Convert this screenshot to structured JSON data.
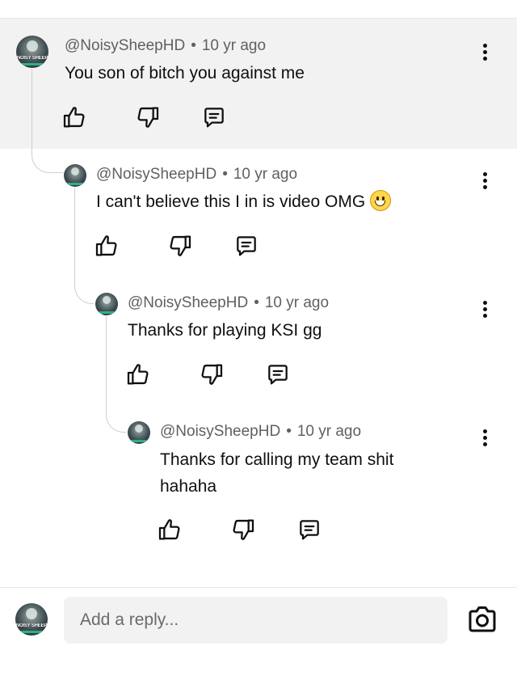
{
  "comments": [
    {
      "author": "@NoisySheepHD",
      "separator": "•",
      "time": "10 yr ago",
      "text": "You son of bitch you against me",
      "avatar_text": "NOISY SHEEP",
      "avatar_icon": "avatar-image",
      "highlighted": true
    },
    {
      "author": "@NoisySheepHD",
      "separator": "•",
      "time": "10 yr ago",
      "text": "I can't believe this I in is video OMG",
      "emoji": "grinning-face-emoji",
      "avatar_icon": "avatar-image"
    },
    {
      "author": "@NoisySheepHD",
      "separator": "•",
      "time": "10 yr ago",
      "text": "Thanks for playing KSI gg",
      "avatar_icon": "avatar-image"
    },
    {
      "author": "@NoisySheepHD",
      "separator": "•",
      "time": "10 yr ago",
      "text": "Thanks for calling my team shit hahaha",
      "avatar_icon": "avatar-image"
    }
  ],
  "actions": {
    "like_icon": "thumbs-up-icon",
    "dislike_icon": "thumbs-down-icon",
    "reply_icon": "reply-comment-icon",
    "more_icon": "more-vertical-icon"
  },
  "reply_bar": {
    "avatar_text": "NOISY SHEEP",
    "placeholder": "Add a reply...",
    "camera_icon": "camera-icon"
  },
  "colors": {
    "highlight_bg": "#f2f2f2",
    "meta_text": "#606060",
    "primary_text": "#0f0f0f",
    "input_bg": "#f2f2f2",
    "thread_line": "#cfcfcf"
  }
}
